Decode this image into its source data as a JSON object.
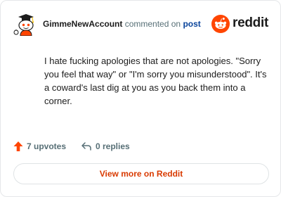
{
  "header": {
    "username": "GimmeNewAccount",
    "commented_text": "commented on",
    "post_link": "post",
    "logo_text": "reddit"
  },
  "comment": {
    "text": "I hate fucking apologies that are not apologies. \"Sorry you feel that way\" or \"I'm sorry you misunderstood\". It's a coward's last dig at you as you back them into a corner."
  },
  "actions": {
    "upvotes": "7 upvotes",
    "replies": "0 replies"
  },
  "footer": {
    "view_more": "View more on Reddit"
  },
  "colors": {
    "brand": "#ff4500",
    "link": "#0a449b",
    "cta": "#d93a00",
    "muted": "#576f76"
  },
  "icons": {
    "avatar": "snoo-avatar-icon",
    "logo": "reddit-logo-icon",
    "upvote": "upvote-arrow-icon",
    "reply": "reply-arrow-icon"
  }
}
